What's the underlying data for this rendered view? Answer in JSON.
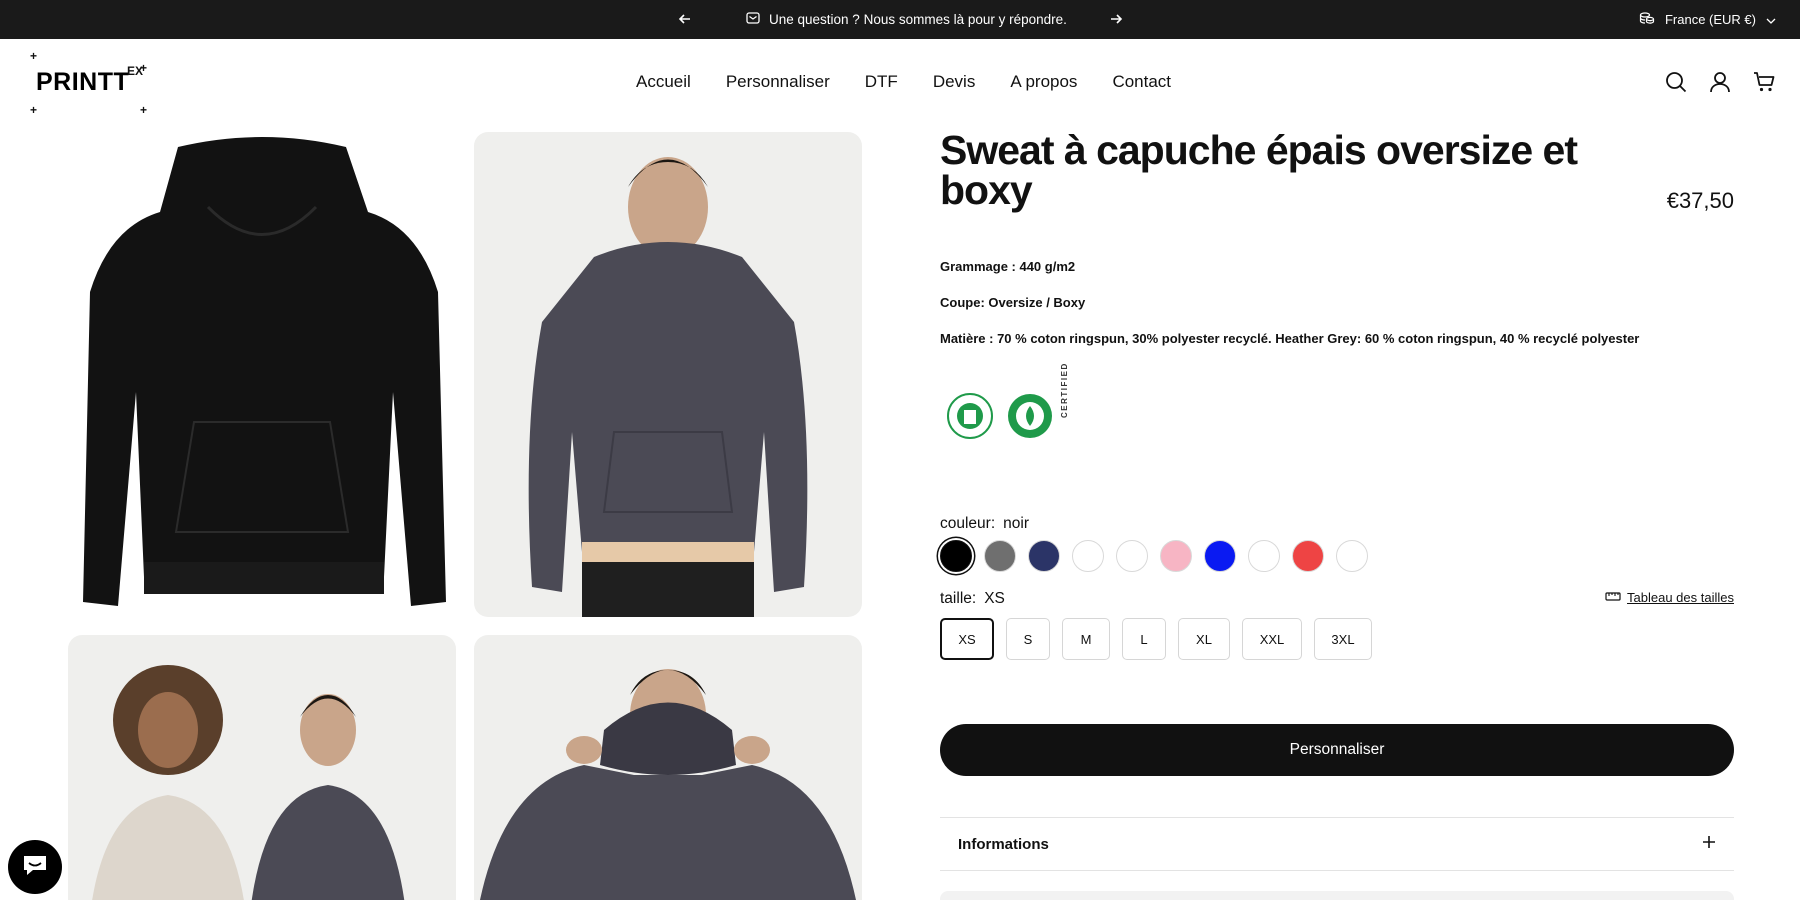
{
  "announcement": {
    "message": "Une question ? Nous sommes là pour y répondre.",
    "locale": "France (EUR €)"
  },
  "header": {
    "logo_text": "PRINTT",
    "logo_suffix": "EX",
    "nav": [
      "Accueil",
      "Personnaliser",
      "DTF",
      "Devis",
      "A propos",
      "Contact"
    ]
  },
  "product": {
    "title": "Sweat à capuche épais oversize et boxy",
    "price": "€37,50",
    "specs": [
      "Grammage : 440 g/m2",
      "Coupe: Oversize / Boxy",
      "Matière : 70 % coton ringspun, 30% polyester recyclé. Heather Grey: 60 % coton ringspun, 40 % recyclé polyester"
    ],
    "cert_text": "CERTIFIED",
    "color_label": "couleur:",
    "color_value": "noir",
    "colors": [
      "#000000",
      "#6f6f6f",
      "#2b3467",
      "#ffffff",
      "#ffffff",
      "#f7b5c4",
      "#0a1af2",
      "#ffffff",
      "#ee4444",
      "#ffffff"
    ],
    "size_label": "taille:",
    "size_value": "XS",
    "size_guide": "Tableau des tailles",
    "sizes": [
      "XS",
      "S",
      "M",
      "L",
      "XL",
      "XXL",
      "3XL"
    ],
    "cta": "Personnaliser",
    "info_title": "Informations"
  }
}
